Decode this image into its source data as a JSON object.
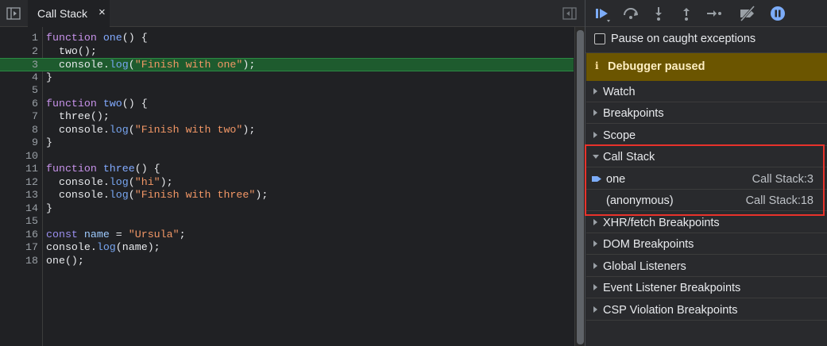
{
  "editor": {
    "tab_label": "Call Stack",
    "tab_close": "×",
    "lines": [
      {
        "n": "1",
        "tokens": [
          [
            "kw",
            "function "
          ],
          [
            "fn",
            "one"
          ],
          [
            "plain",
            "() {"
          ]
        ]
      },
      {
        "n": "2",
        "tokens": [
          [
            "plain",
            "  two();"
          ]
        ]
      },
      {
        "n": "3",
        "exec": true,
        "tokens": [
          [
            "plain",
            "  console."
          ],
          [
            "fn2",
            "log"
          ],
          [
            "plain",
            "("
          ],
          [
            "str",
            "\"Finish with one\""
          ],
          [
            "plain",
            ");"
          ]
        ]
      },
      {
        "n": "4",
        "tokens": [
          [
            "plain",
            "}"
          ]
        ]
      },
      {
        "n": "5",
        "tokens": []
      },
      {
        "n": "6",
        "tokens": [
          [
            "kw",
            "function "
          ],
          [
            "fn",
            "two"
          ],
          [
            "plain",
            "() {"
          ]
        ]
      },
      {
        "n": "7",
        "tokens": [
          [
            "plain",
            "  three();"
          ]
        ]
      },
      {
        "n": "8",
        "tokens": [
          [
            "plain",
            "  console."
          ],
          [
            "fn2",
            "log"
          ],
          [
            "plain",
            "("
          ],
          [
            "str",
            "\"Finish with two\""
          ],
          [
            "plain",
            ");"
          ]
        ]
      },
      {
        "n": "9",
        "tokens": [
          [
            "plain",
            "}"
          ]
        ]
      },
      {
        "n": "10",
        "tokens": []
      },
      {
        "n": "11",
        "tokens": [
          [
            "kw",
            "function "
          ],
          [
            "fn",
            "three"
          ],
          [
            "plain",
            "() {"
          ]
        ]
      },
      {
        "n": "12",
        "tokens": [
          [
            "plain",
            "  console."
          ],
          [
            "fn2",
            "log"
          ],
          [
            "plain",
            "("
          ],
          [
            "str",
            "\"hi\""
          ],
          [
            "plain",
            ");"
          ]
        ]
      },
      {
        "n": "13",
        "tokens": [
          [
            "plain",
            "  console."
          ],
          [
            "fn2",
            "log"
          ],
          [
            "plain",
            "("
          ],
          [
            "str",
            "\"Finish with three\""
          ],
          [
            "plain",
            ");"
          ]
        ]
      },
      {
        "n": "14",
        "tokens": [
          [
            "plain",
            "}"
          ]
        ]
      },
      {
        "n": "15",
        "tokens": []
      },
      {
        "n": "16",
        "tokens": [
          [
            "kw2",
            "const "
          ],
          [
            "prop",
            "name"
          ],
          [
            "plain",
            " = "
          ],
          [
            "str",
            "\"Ursula\""
          ],
          [
            "plain",
            ";"
          ]
        ]
      },
      {
        "n": "17",
        "tokens": [
          [
            "plain",
            "console."
          ],
          [
            "fn2",
            "log"
          ],
          [
            "plain",
            "(name);"
          ]
        ]
      },
      {
        "n": "18",
        "tokens": [
          [
            "plain",
            "one();"
          ]
        ]
      }
    ]
  },
  "debugger": {
    "pause_on_caught_label": "Pause on caught exceptions",
    "pause_on_caught_checked": false,
    "paused_icon": "i",
    "paused_text": "Debugger paused",
    "panes_top": [
      {
        "label": "Watch",
        "key": "watch"
      },
      {
        "label": "Breakpoints",
        "key": "breakpoints"
      },
      {
        "label": "Scope",
        "key": "scope"
      }
    ],
    "call_stack": {
      "label": "Call Stack",
      "frames": [
        {
          "name": "one",
          "location": "Call Stack:3",
          "current": true
        },
        {
          "name": "(anonymous)",
          "location": "Call Stack:18",
          "current": false
        }
      ]
    },
    "panes_bottom": [
      {
        "label": "XHR/fetch Breakpoints",
        "key": "xhr-fetch-breakpoints"
      },
      {
        "label": "DOM Breakpoints",
        "key": "dom-breakpoints"
      },
      {
        "label": "Global Listeners",
        "key": "global-listeners"
      },
      {
        "label": "Event Listener Breakpoints",
        "key": "event-listener-breakpoints"
      },
      {
        "label": "CSP Violation Breakpoints",
        "key": "csp-violation-breakpoints"
      }
    ]
  },
  "colors": {
    "accent": "#7cacf8",
    "exec_line": "#1e5b2e",
    "paused_banner": "#6b5500",
    "highlight_box": "#e8322b"
  }
}
